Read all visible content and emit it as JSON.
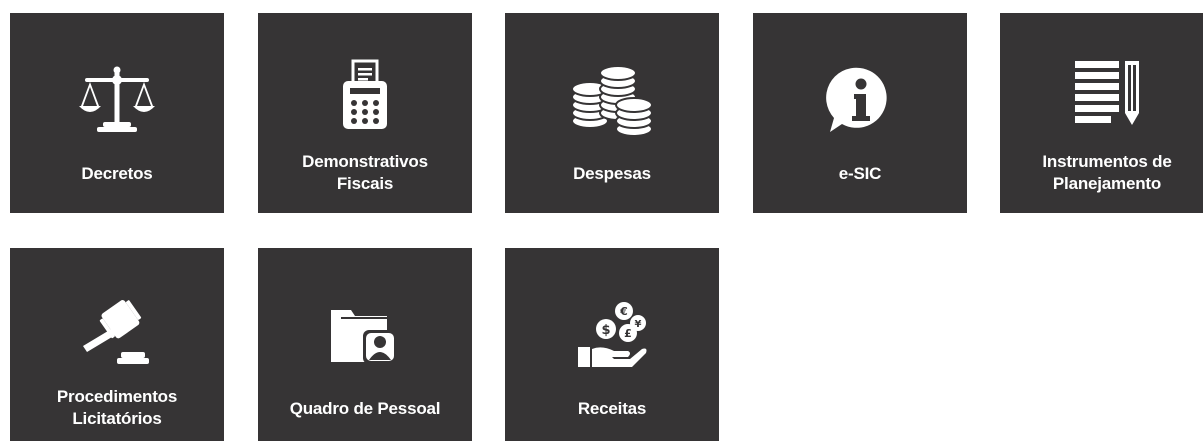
{
  "tiles": [
    {
      "label": "Decretos",
      "icon": "scales-icon"
    },
    {
      "label": "Demonstrativos\nFiscais",
      "icon": "calculator-receipt-icon"
    },
    {
      "label": "Despesas",
      "icon": "coin-stacks-icon"
    },
    {
      "label": "e-SIC",
      "icon": "info-speech-bubble-icon"
    },
    {
      "label": "Instrumentos de\nPlanejamento",
      "icon": "document-pencil-icon"
    },
    {
      "label": "Procedimentos\nLicitatórios",
      "icon": "gavel-icon"
    },
    {
      "label": "Quadro de Pessoal",
      "icon": "folder-person-icon"
    },
    {
      "label": "Receitas",
      "icon": "hand-coins-icon"
    }
  ],
  "colors": {
    "tile_background": "#363435",
    "tile_foreground": "#ffffff",
    "page_background": "#ffffff"
  }
}
